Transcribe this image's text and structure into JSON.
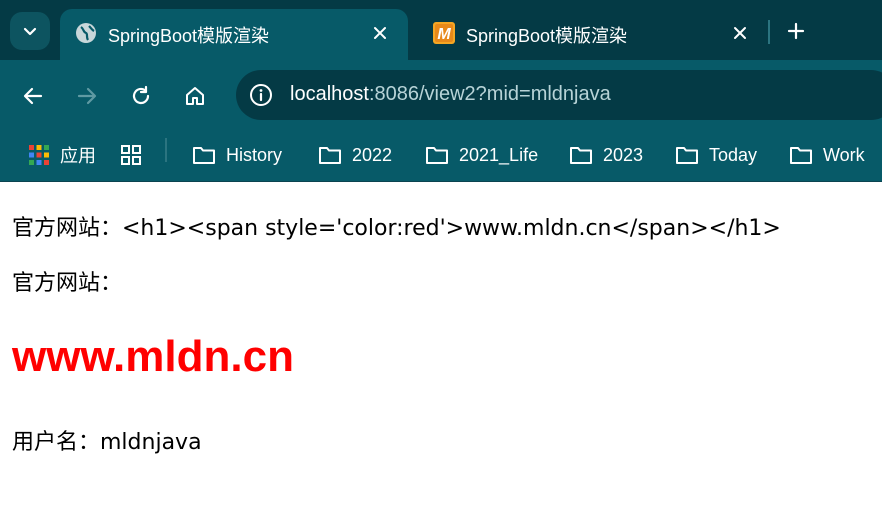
{
  "tabs": [
    {
      "title": "SpringBoot模版渲染",
      "active": true,
      "favicon": "globe-icon"
    },
    {
      "title": "SpringBoot模版渲染",
      "active": false,
      "favicon": "m-logo-icon"
    }
  ],
  "address_bar": {
    "host": "localhost",
    "path": ":8086/view2?mid=mldnjava"
  },
  "bookmarks": {
    "apps_label": "应用",
    "folders": [
      "History",
      "2022",
      "2021_Life",
      "2023",
      "Today",
      "Work"
    ]
  },
  "page": {
    "line1": "官方网站：<h1><span style='color:red'>www.mldn.cn</span></h1>",
    "line2": "官方网站：",
    "heading": "www.mldn.cn",
    "user_line": "用户名：mldnjava"
  },
  "colors": {
    "tabstrip_bg": "#043a45",
    "toolbar_bg": "#075a68",
    "heading_color": "#ff0000"
  }
}
